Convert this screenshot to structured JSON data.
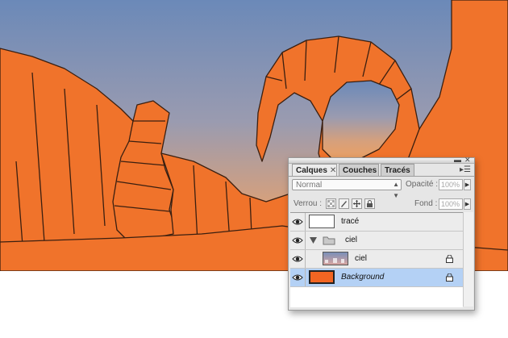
{
  "panel": {
    "tabs": [
      {
        "label": "Calques",
        "close": "✕"
      },
      {
        "label": "Couches"
      },
      {
        "label": "Tracés"
      }
    ],
    "blend_mode": "Normal",
    "opacity_label": "Opacité :",
    "opacity_value": "100%",
    "lock_label": "Verrou :",
    "fill_label": "Fond :",
    "fill_value": "100%",
    "layers": [
      {
        "name": "tracé",
        "visible": true
      },
      {
        "name": "ciel",
        "type": "group",
        "expanded": true,
        "visible": true
      },
      {
        "name": "ciel",
        "visible": true,
        "locked": true
      },
      {
        "name": "Background",
        "visible": true,
        "locked": true,
        "selected": true
      }
    ],
    "colors": {
      "selection": "#b4d1f5",
      "background_layer": "#f26522"
    }
  },
  "illustration": {
    "colors": {
      "rock": "#f0732b",
      "sky_top": "#6b89b8",
      "sky_bottom": "#e9a062",
      "outline": "#3a1f10"
    }
  }
}
